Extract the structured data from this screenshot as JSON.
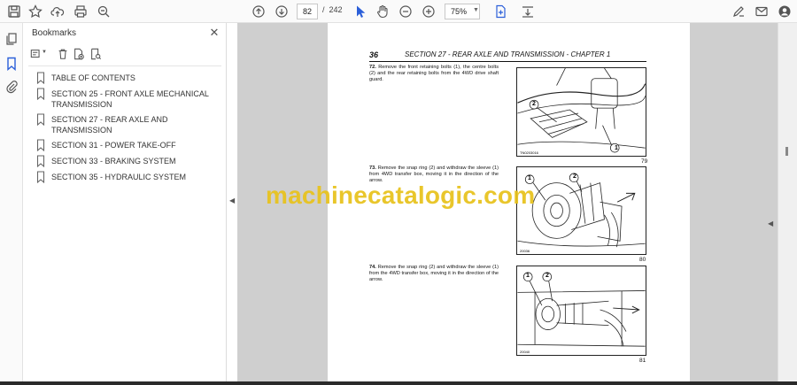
{
  "toolbar": {
    "page_current": "82",
    "page_separator": "/",
    "page_total": "242",
    "zoom": "75%"
  },
  "bookmarks": {
    "title": "Bookmarks",
    "close": "✕",
    "items": [
      {
        "label": "TABLE OF CONTENTS"
      },
      {
        "label": "SECTION 25 - FRONT AXLE MECHANICAL TRANSMISSION"
      },
      {
        "label": "SECTION 27 - REAR AXLE AND TRANSMISSION"
      },
      {
        "label": "SECTION 31 - POWER TAKE-OFF"
      },
      {
        "label": "SECTION 33 - BRAKING SYSTEM"
      },
      {
        "label": "SECTION 35 - HYDRAULIC SYSTEM"
      }
    ]
  },
  "document": {
    "header_number": "36",
    "header_title": "SECTION 27 - REAR AXLE AND TRANSMISSION - CHAPTER 1",
    "steps": [
      {
        "num": "72.",
        "text": "Remove the front retaining bolts (1), the centre bolts (2) and the rear retaining bolts from the 4WD drive shaft guard.",
        "fig_num": "79",
        "fig_code": "TN0203016",
        "callouts": [
          "1",
          "2"
        ]
      },
      {
        "num": "73.",
        "text": "Remove the snap ring (2) and withdraw the sleeve (1) from 4WD transfer box, moving it in the direction of the arrow.",
        "fig_num": "80",
        "fig_code": "20036",
        "callouts": [
          "1",
          "2"
        ]
      },
      {
        "num": "74.",
        "text": "Remove the snap ring (2) and withdraw the sleeve (1) from the 4WD transfer box, moving it in the direction of the arrow.",
        "fig_num": "81",
        "fig_code": "20040",
        "callouts": [
          "1",
          "2"
        ]
      }
    ]
  },
  "watermark": "machinecatalogic.com"
}
